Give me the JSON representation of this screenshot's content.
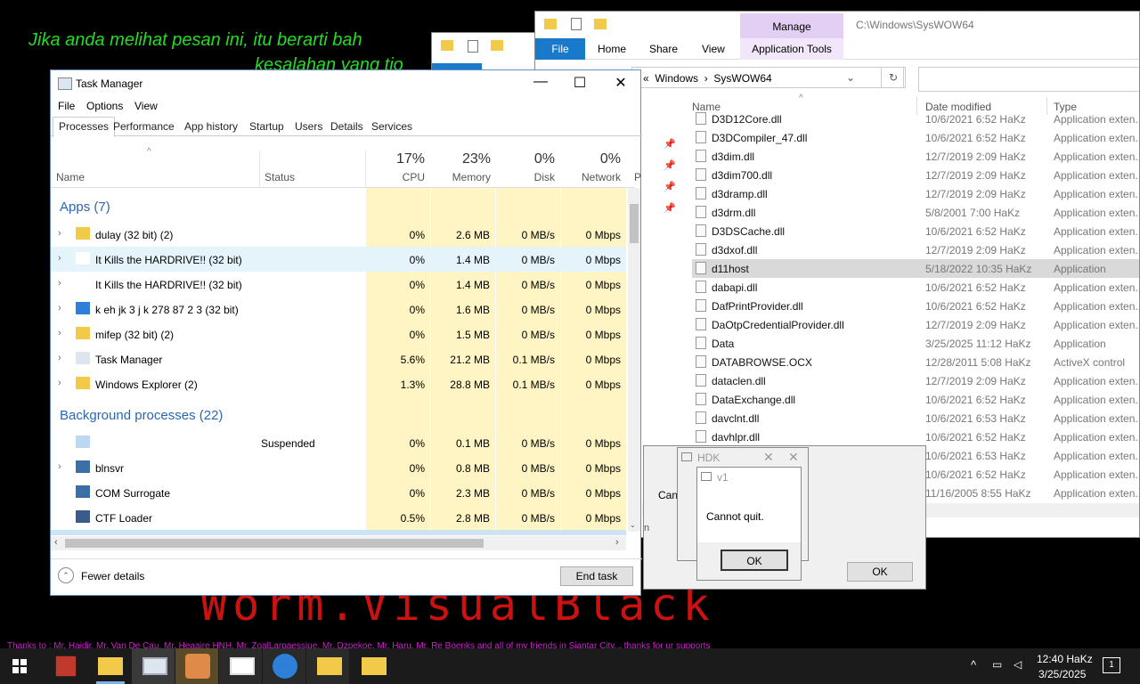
{
  "desktop": {
    "message_line1": "Jika anda melihat pesan ini, itu berarti bah",
    "message_line2": "kesalahan yang tio",
    "worm_text": "Worm.VisualBlack",
    "thanks": "Thanks to :   Mr. Haidir, Mr. Van De Cau, Mr. Heaaire HNH, Mr. ZoalLarpaessiue, Mr. Dzpekoe, Mr. Haru, Mr. Re Boenks and all of my friends in Siantar City... thanks for ur supports"
  },
  "explorer": {
    "manage_tab": "Manage",
    "path_title": "C:\\Windows\\SysWOW64",
    "ribbon": [
      "Home",
      "Share",
      "View"
    ],
    "file_tab": "File",
    "app_tools": "Application Tools",
    "address": [
      "Windows",
      "SysWOW64"
    ],
    "columns": {
      "name": "Name",
      "date": "Date modified",
      "type": "Type"
    },
    "rows": [
      {
        "name": "D3D12Core.dll",
        "date": "10/6/2021 6:52 HaKz",
        "type": "Application exten..."
      },
      {
        "name": "D3DCompiler_47.dll",
        "date": "10/6/2021 6:52 HaKz",
        "type": "Application exten..."
      },
      {
        "name": "d3dim.dll",
        "date": "12/7/2019 2:09 HaKz",
        "type": "Application exten..."
      },
      {
        "name": "d3dim700.dll",
        "date": "12/7/2019 2:09 HaKz",
        "type": "Application exten..."
      },
      {
        "name": "d3dramp.dll",
        "date": "12/7/2019 2:09 HaKz",
        "type": "Application exten..."
      },
      {
        "name": "d3drm.dll",
        "date": "5/8/2001 7:00 HaKz",
        "type": "Application exten..."
      },
      {
        "name": "D3DSCache.dll",
        "date": "10/6/2021 6:52 HaKz",
        "type": "Application exten..."
      },
      {
        "name": "d3dxof.dll",
        "date": "12/7/2019 2:09 HaKz",
        "type": "Application exten..."
      },
      {
        "name": "d11host",
        "date": "5/18/2022 10:35 HaKz",
        "type": "Application"
      },
      {
        "name": "dabapi.dll",
        "date": "10/6/2021 6:52 HaKz",
        "type": "Application exten..."
      },
      {
        "name": "DafPrintProvider.dll",
        "date": "10/6/2021 6:52 HaKz",
        "type": "Application exten..."
      },
      {
        "name": "DaOtpCredentialProvider.dll",
        "date": "12/7/2019 2:09 HaKz",
        "type": "Application exten..."
      },
      {
        "name": "Data",
        "date": "3/25/2025 11:12 HaKz",
        "type": "Application"
      },
      {
        "name": "DATABROWSE.OCX",
        "date": "12/28/2011 5:08 HaKz",
        "type": "ActiveX control"
      },
      {
        "name": "dataclen.dll",
        "date": "12/7/2019 2:09 HaKz",
        "type": "Application exten..."
      },
      {
        "name": "DataExchange.dll",
        "date": "10/6/2021 6:52 HaKz",
        "type": "Application exten..."
      },
      {
        "name": "davclnt.dll",
        "date": "10/6/2021 6:53 HaKz",
        "type": "Application exten..."
      },
      {
        "name": "davhlpr.dll",
        "date": "10/6/2021 6:52 HaKz",
        "type": "Application exten..."
      },
      {
        "name": "",
        "date": "10/6/2021 6:53 HaKz",
        "type": "Application exten..."
      },
      {
        "name": "",
        "date": "10/6/2021 6:52 HaKz",
        "type": "Application exten..."
      },
      {
        "name": "",
        "date": "11/16/2005 8:55 HaKz",
        "type": "Application exten..."
      }
    ]
  },
  "taskmanager": {
    "title": "Task Manager",
    "menu": [
      "File",
      "Options",
      "View"
    ],
    "tabs": [
      "Processes",
      "Performance",
      "App history",
      "Startup",
      "Users",
      "Details",
      "Services"
    ],
    "col_name": "Name",
    "col_status": "Status",
    "cpu": {
      "pct": "17%",
      "label": "CPU"
    },
    "memory": {
      "pct": "23%",
      "label": "Memory"
    },
    "disk": {
      "pct": "0%",
      "label": "Disk"
    },
    "network": {
      "pct": "0%",
      "label": "Network"
    },
    "col_p": "P",
    "apps_group": "Apps (7)",
    "bg_group": "Background processes (22)",
    "apps": [
      {
        "name": "dulay (32 bit) (2)",
        "status": "",
        "cpu": "0%",
        "mem": "2.6 MB",
        "disk": "0 MB/s",
        "net": "0 Mbps"
      },
      {
        "name": "It Kills the HARDRIVE!! (32 bit)",
        "status": "",
        "cpu": "0%",
        "mem": "1.4 MB",
        "disk": "0 MB/s",
        "net": "0 Mbps"
      },
      {
        "name": "It Kills the HARDRIVE!! (32 bit)",
        "status": "",
        "cpu": "0%",
        "mem": "1.4 MB",
        "disk": "0 MB/s",
        "net": "0 Mbps"
      },
      {
        "name": "k eh   jk  3 j k 278 87 2 3 (32 bit)",
        "status": "",
        "cpu": "0%",
        "mem": "1.6 MB",
        "disk": "0 MB/s",
        "net": "0 Mbps"
      },
      {
        "name": "mifep (32 bit) (2)",
        "status": "",
        "cpu": "0%",
        "mem": "1.5 MB",
        "disk": "0 MB/s",
        "net": "0 Mbps"
      },
      {
        "name": "Task Manager",
        "status": "",
        "cpu": "5.6%",
        "mem": "21.2 MB",
        "disk": "0.1 MB/s",
        "net": "0 Mbps"
      },
      {
        "name": "Windows Explorer (2)",
        "status": "",
        "cpu": "1.3%",
        "mem": "28.8 MB",
        "disk": "0.1 MB/s",
        "net": "0 Mbps"
      }
    ],
    "bg": [
      {
        "name": "",
        "status": "Suspended",
        "cpu": "0%",
        "mem": "0.1 MB",
        "disk": "0 MB/s",
        "net": "0 Mbps"
      },
      {
        "name": "blnsvr",
        "status": "",
        "cpu": "0%",
        "mem": "0.8 MB",
        "disk": "0 MB/s",
        "net": "0 Mbps"
      },
      {
        "name": "COM Surrogate",
        "status": "",
        "cpu": "0%",
        "mem": "2.3 MB",
        "disk": "0 MB/s",
        "net": "0 Mbps"
      },
      {
        "name": "CTF Loader",
        "status": "",
        "cpu": "0.5%",
        "mem": "2.8 MB",
        "disk": "0 MB/s",
        "net": "0 Mbps"
      }
    ],
    "fewer_details": "Fewer details",
    "end_task": "End task"
  },
  "dialogs": {
    "hdk_title": "HDK",
    "v1_title": "v1",
    "message": "Cannot quit.",
    "ok": "OK",
    "back_ok": "OK",
    "back_partial": "Can"
  },
  "taskbar": {
    "time": "12:40 HaKz",
    "date": "3/25/2025",
    "notif_count": "1"
  }
}
